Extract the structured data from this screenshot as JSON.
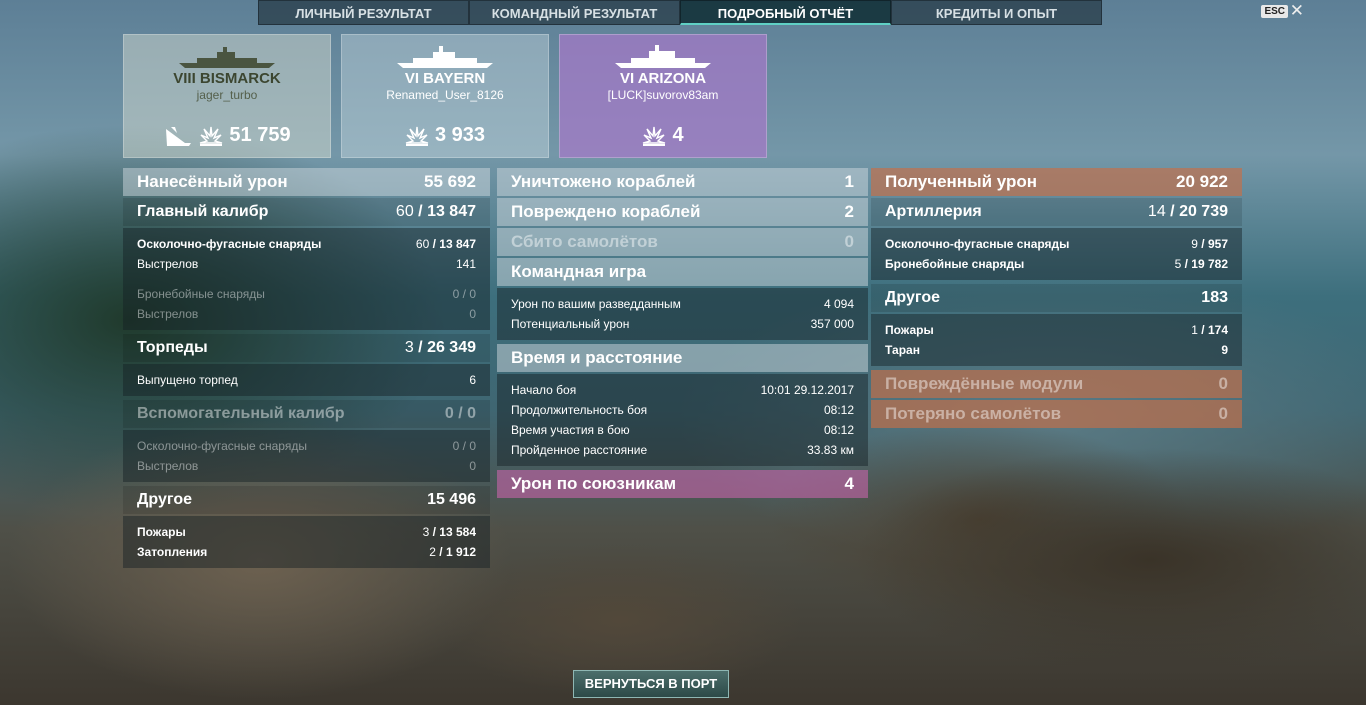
{
  "tabs": [
    "ЛИЧНЫЙ РЕЗУЛЬТАТ",
    "КОМАНДНЫЙ РЕЗУЛЬТАТ",
    "ПОДРОБНЫЙ ОТЧЁТ",
    "КРЕДИТЫ И ОПЫТ"
  ],
  "active_tab": 2,
  "esc_label": "ESC",
  "close_glyph": "✕",
  "cards": [
    {
      "ship": "VIII BISMARCK",
      "player": "jager_turbo",
      "damage": "51 759",
      "icons": [
        "sunk-ship-icon",
        "damage-icon"
      ]
    },
    {
      "ship": "VI BAYERN",
      "player": "Renamed_User_8126",
      "damage": "3 933",
      "icons": [
        "damage-icon"
      ]
    },
    {
      "ship": "VI ARIZONA",
      "player": "[LUCK]suvorov83am",
      "damage": "4",
      "icons": [
        "damage-icon"
      ]
    }
  ],
  "left": {
    "dealt": {
      "label": "Нанесённый урон",
      "value": "55 692"
    },
    "main": {
      "label": "Главный калибр",
      "a": "60",
      "b": "13 847"
    },
    "main_lines": [
      {
        "label": "Осколочно-фугасные снаряды",
        "a": "60",
        "b": "13 847"
      },
      {
        "label": "Выстрелов",
        "v": "141"
      },
      {
        "label": "Бронебойные снаряды",
        "a": "0",
        "b": "0"
      },
      {
        "label": "Выстрелов",
        "v": "0"
      }
    ],
    "torp": {
      "label": "Торпеды",
      "a": "3",
      "b": "26 349"
    },
    "torp_lines": [
      {
        "label": "Выпущено торпед",
        "v": "6"
      }
    ],
    "sec": {
      "label": "Вспомогательный калибр",
      "a": "0",
      "b": "0"
    },
    "sec_lines": [
      {
        "label": "Осколочно-фугасные снаряды",
        "a": "0",
        "b": "0"
      },
      {
        "label": "Выстрелов",
        "v": "0"
      }
    ],
    "other": {
      "label": "Другое",
      "value": "15 496"
    },
    "other_lines": [
      {
        "label": "Пожары",
        "a": "3",
        "b": "13 584"
      },
      {
        "label": "Затопления",
        "a": "2",
        "b": "1 912"
      }
    ]
  },
  "mid": {
    "destroyed": {
      "label": "Уничтожено кораблей",
      "value": "1"
    },
    "damaged": {
      "label": "Повреждено кораблей",
      "value": "2"
    },
    "planes": {
      "label": "Сбито самолётов",
      "value": "0"
    },
    "team": {
      "label": "Командная игра"
    },
    "team_lines": [
      {
        "label": "Урон по вашим разведданным",
        "v": "4 094"
      },
      {
        "label": "Потенциальный урон",
        "v": "357 000"
      }
    ],
    "time": {
      "label": "Время и расстояние"
    },
    "time_lines": [
      {
        "label": "Начало боя",
        "v": "10:01  29.12.2017"
      },
      {
        "label": "Продолжительность боя",
        "v": "08:12"
      },
      {
        "label": "Время участия в бою",
        "v": "08:12"
      },
      {
        "label": "Пройденное расстояние",
        "v": "33.83 км"
      }
    ],
    "ally": {
      "label": "Урон по союзникам",
      "value": "4"
    }
  },
  "right": {
    "received": {
      "label": "Полученный урон",
      "value": "20 922"
    },
    "art": {
      "label": "Артиллерия",
      "a": "14",
      "b": "20 739"
    },
    "art_lines": [
      {
        "label": "Осколочно-фугасные снаряды",
        "a": "9",
        "b": "957"
      },
      {
        "label": "Бронебойные снаряды",
        "a": "5",
        "b": "19 782"
      }
    ],
    "other": {
      "label": "Другое",
      "value": "183"
    },
    "other_lines": [
      {
        "label": "Пожары",
        "a": "1",
        "b": "174"
      },
      {
        "label": "Таран",
        "v": "9"
      }
    ],
    "modules": {
      "label": "Повреждённые модули",
      "value": "0"
    },
    "planes_lost": {
      "label": "Потеряно самолётов",
      "value": "0"
    }
  },
  "back_label": "ВЕРНУТЬСЯ В ПОРТ"
}
